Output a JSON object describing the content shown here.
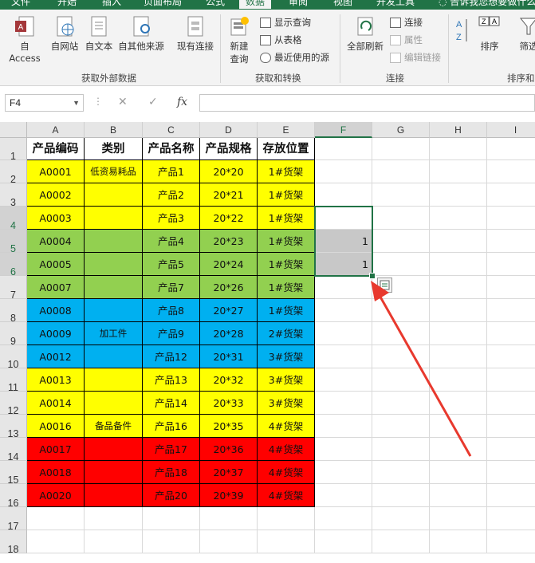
{
  "tabs": {
    "file": "文件",
    "home": "开始",
    "insert": "插入",
    "layout": "页面布局",
    "formulas": "公式",
    "data": "数据",
    "review": "审阅",
    "view": "视图",
    "developer": "开发工具",
    "tell_me": "告诉我您想要做什么"
  },
  "ribbon": {
    "get_external": {
      "label": "获取外部数据",
      "from_access": "自 Access",
      "from_web": "自网站",
      "from_text": "自文本",
      "from_other": "自其他来源",
      "existing": "现有连接"
    },
    "get_transform": {
      "label": "获取和转换",
      "new_query_1": "新建",
      "new_query_2": "查询",
      "show_queries": "显示查询",
      "from_table": "从表格",
      "recent_sources": "最近使用的源"
    },
    "connections": {
      "label": "连接",
      "refresh_all": "全部刷新",
      "connections": "连接",
      "properties": "属性",
      "edit_links": "编辑链接"
    },
    "sort_filter": {
      "label": "排序和",
      "sort": "排序",
      "filter": "筛选"
    }
  },
  "formula_bar": {
    "name_box": "F4",
    "fx": "fx",
    "cancel": "✕",
    "enter": "✓",
    "formula": ""
  },
  "columns": [
    "A",
    "B",
    "C",
    "D",
    "E",
    "F",
    "G",
    "H",
    "I"
  ],
  "selected_column": "F",
  "rows": [
    "1",
    "2",
    "3",
    "4",
    "5",
    "6",
    "7",
    "8",
    "9",
    "10",
    "11",
    "12",
    "13",
    "14",
    "15",
    "16",
    "17",
    "18"
  ],
  "selected_rows": [
    "4",
    "5",
    "6"
  ],
  "table": {
    "headers": [
      "产品编码",
      "类别",
      "产品名称",
      "产品规格",
      "存放位置"
    ],
    "records": [
      {
        "code": "A0001",
        "cat": "低资易耗品",
        "name": "产品1",
        "spec": "20*20",
        "loc": "1#货架",
        "fill": "#ffff00"
      },
      {
        "code": "A0002",
        "cat": "",
        "name": "产品2",
        "spec": "20*21",
        "loc": "1#货架",
        "fill": "#ffff00"
      },
      {
        "code": "A0003",
        "cat": "",
        "name": "产品3",
        "spec": "20*22",
        "loc": "1#货架",
        "fill": "#ffff00"
      },
      {
        "code": "A0004",
        "cat": "",
        "name": "产品4",
        "spec": "20*23",
        "loc": "1#货架",
        "fill": "#92d050"
      },
      {
        "code": "A0005",
        "cat": "",
        "name": "产品5",
        "spec": "20*24",
        "loc": "1#货架",
        "fill": "#92d050"
      },
      {
        "code": "A0007",
        "cat": "",
        "name": "产品7",
        "spec": "20*26",
        "loc": "1#货架",
        "fill": "#92d050"
      },
      {
        "code": "A0008",
        "cat": "",
        "name": "产品8",
        "spec": "20*27",
        "loc": "1#货架",
        "fill": "#00b0f0"
      },
      {
        "code": "A0009",
        "cat": "加工件",
        "name": "产品9",
        "spec": "20*28",
        "loc": "2#货架",
        "fill": "#00b0f0"
      },
      {
        "code": "A0012",
        "cat": "",
        "name": "产品12",
        "spec": "20*31",
        "loc": "3#货架",
        "fill": "#00b0f0"
      },
      {
        "code": "A0013",
        "cat": "",
        "name": "产品13",
        "spec": "20*32",
        "loc": "3#货架",
        "fill": "#ffff00"
      },
      {
        "code": "A0014",
        "cat": "",
        "name": "产品14",
        "spec": "20*33",
        "loc": "3#货架",
        "fill": "#ffff00"
      },
      {
        "code": "A0016",
        "cat": "备品备件",
        "name": "产品16",
        "spec": "20*35",
        "loc": "4#货架",
        "fill": "#ffff00"
      },
      {
        "code": "A0017",
        "cat": "",
        "name": "产品17",
        "spec": "20*36",
        "loc": "4#货架",
        "fill": "#ff0000"
      },
      {
        "code": "A0018",
        "cat": "",
        "name": "产品18",
        "spec": "20*37",
        "loc": "4#货架",
        "fill": "#ff0000"
      },
      {
        "code": "A0020",
        "cat": "",
        "name": "产品20",
        "spec": "20*39",
        "loc": "4#货架",
        "fill": "#ff0000"
      }
    ]
  },
  "f_column_values": [
    "",
    "",
    "",
    "1",
    "1"
  ],
  "colors": {
    "excel_green": "#217346",
    "arrow_red": "#e8392e",
    "selected_gray": "#c8c8c8"
  }
}
